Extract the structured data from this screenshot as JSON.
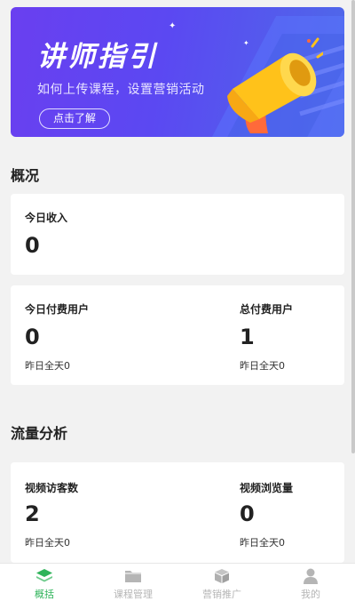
{
  "banner": {
    "title": "讲师指引",
    "subtitle": "如何上传课程，设置营销活动",
    "button_label": "点击了解"
  },
  "overview": {
    "title": "概况",
    "today_income": {
      "label": "今日收入",
      "value": "0"
    },
    "today_paid_users": {
      "label": "今日付费用户",
      "value": "0",
      "sub": "昨日全天0"
    },
    "total_paid_users": {
      "label": "总付费用户",
      "value": "1",
      "sub": "昨日全天0"
    }
  },
  "traffic": {
    "title": "流量分析",
    "video_visitors": {
      "label": "视频访客数",
      "value": "2",
      "sub": "昨日全天0"
    },
    "video_views": {
      "label": "视频浏览量",
      "value": "0",
      "sub": "昨日全天0"
    }
  },
  "tabbar": {
    "items": [
      {
        "label": "概括",
        "icon": "layers-icon",
        "active": true
      },
      {
        "label": "课程管理",
        "icon": "folder-icon",
        "active": false
      },
      {
        "label": "营销推广",
        "icon": "box-icon",
        "active": false
      },
      {
        "label": "我的",
        "icon": "user-icon",
        "active": false
      }
    ]
  },
  "colors": {
    "accent": "#2fb35a",
    "banner_start": "#6a3ff0",
    "banner_end": "#4e6ae8",
    "megaphone_yellow": "#ffc21a",
    "megaphone_orange": "#ff6a3a"
  }
}
